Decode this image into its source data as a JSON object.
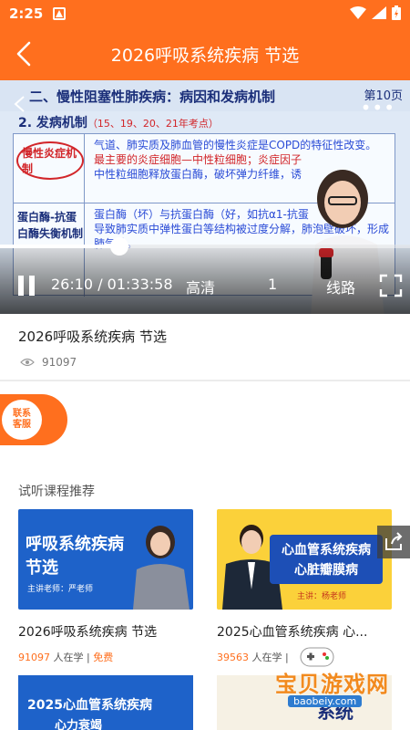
{
  "status_bar": {
    "time": "2:25"
  },
  "header": {
    "title": "2026呼吸系统疾病 节选"
  },
  "player": {
    "slide": {
      "title": "二、慢性阻塞性肺疾病：病因和发病机制",
      "page": "第10页",
      "subtitle": "2. 发病机制",
      "subtitle_note": "（15、19、20、21年考点）",
      "rows": [
        {
          "label": "慢性炎症机制",
          "text_blue": "气道、肺实质及肺血管的慢性炎症是COPD的特征性改变。",
          "text_red": "最主要的炎症细胞—中性粒细胞；炎症因子",
          "text_blue2": "中性粒细胞释放蛋白酶，破坏弹力纤维，诱"
        },
        {
          "label": "蛋白酶-抗蛋白酶失衡机制",
          "text_blue": "蛋白酶（坏）与抗蛋白酶（好，如抗α1-抗蛋",
          "text_red": "",
          "text_blue2": "导致肺实质中弹性蛋白等结构被过度分解，肺泡壁破坏，形成肺气肿。"
        }
      ]
    },
    "progress": 0.29,
    "time_display": "26:10 / 01:33:58",
    "quality": "高清",
    "speed": "1",
    "route": "线路"
  },
  "course": {
    "title": "2026呼吸系统疾病 节选",
    "views": "91097"
  },
  "contact": {
    "label": "联系客服"
  },
  "recommend": {
    "section_title": "试听课程推荐",
    "cards": [
      {
        "thumb_title_1": "呼吸系统疾病",
        "thumb_title_2": "节选",
        "thumb_teacher": "主讲老师：严老师",
        "name": "2026呼吸系统疾病 节选",
        "count": "91097",
        "count_suffix": " 人在学 |",
        "tag": " 免费"
      },
      {
        "thumb_title_1": "心血管系统疾病",
        "thumb_title_2": "心脏瓣膜病",
        "thumb_teacher": "主讲：杨老师",
        "name": "2025心血管系统疾病 心...",
        "count": "39563",
        "count_suffix": " 人在学 |",
        "tag": ""
      }
    ],
    "row2": [
      {
        "thumb_title_1": "2025心血管系统疾病",
        "thumb_title_2": "心力衰竭"
      },
      {
        "thumb_title_1": "系统"
      }
    ]
  },
  "watermark": {
    "text": "宝贝游戏网",
    "url": "baobeiy.com"
  },
  "colors": {
    "accent": "#ff6f1e",
    "slide_blue": "#1b2f7a",
    "slide_red": "#d2262a"
  }
}
